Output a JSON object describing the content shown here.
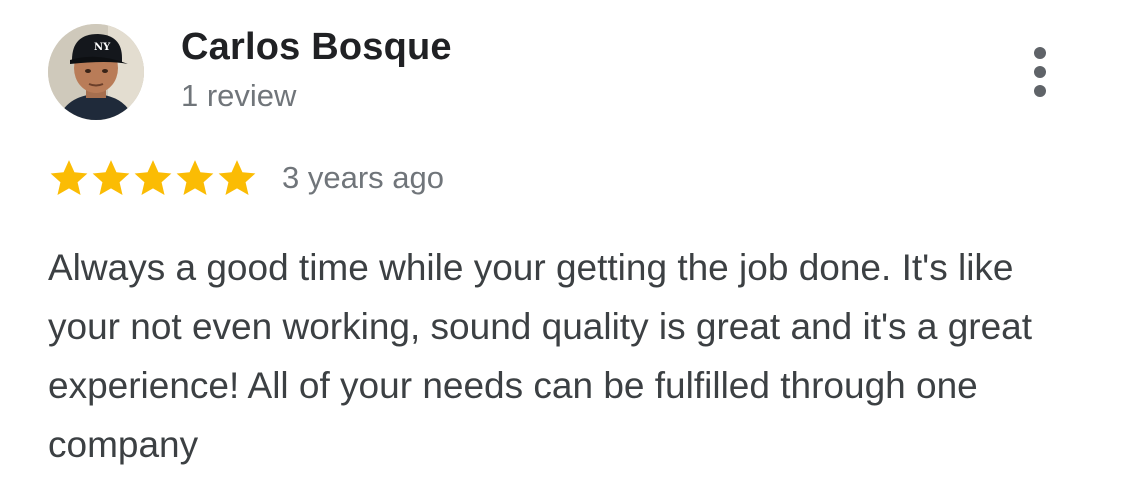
{
  "review": {
    "reviewer_name": "Carlos Bosque",
    "review_count": "1 review",
    "rating": 5,
    "rating_max": 5,
    "time_ago": "3 years ago",
    "text": "Always a good time while your getting the job done. It's like your not even working, sound quality is great and it's a great experience! All of your needs can be fulfilled through one company"
  },
  "icons": {
    "avatar": "avatar-photo",
    "more": "more-vert-icon",
    "star": "star-icon"
  },
  "colors": {
    "star": "#fbbc04",
    "name": "#202124",
    "secondary": "#70757a",
    "body": "#3c4043"
  }
}
